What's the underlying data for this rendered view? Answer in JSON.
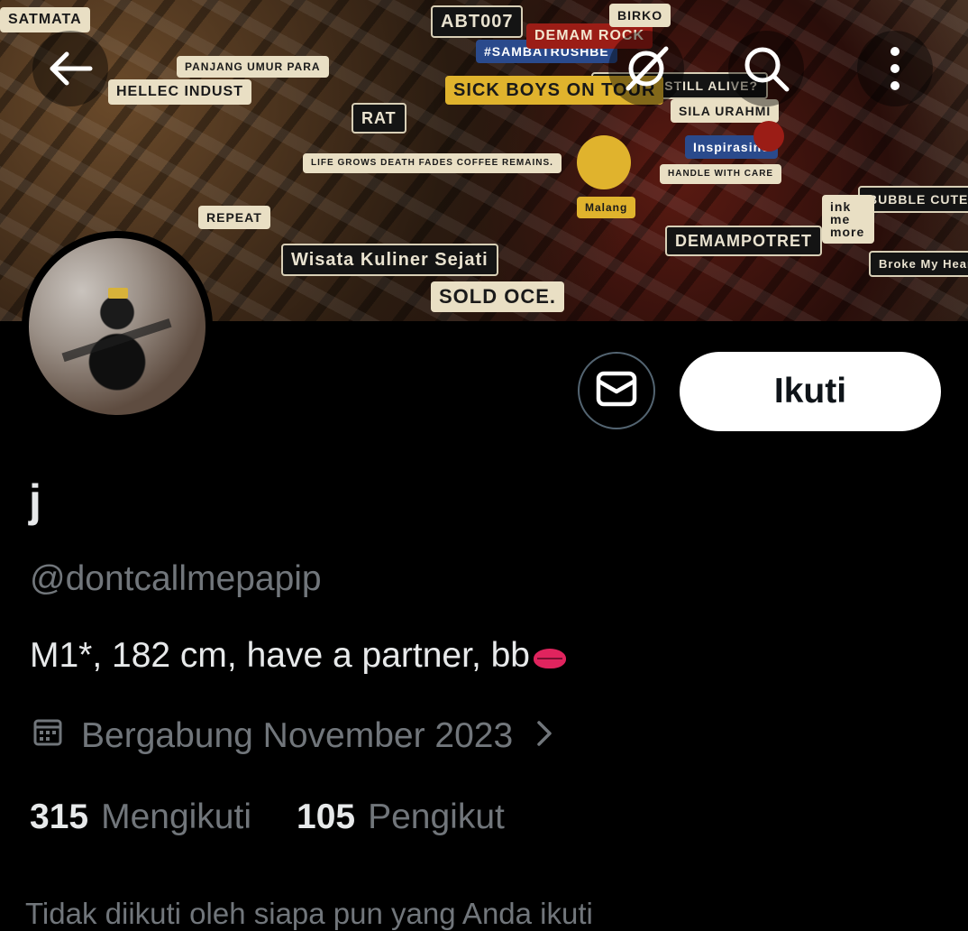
{
  "banner": {
    "stickers": [
      "SATMATA",
      "PANJANG UMUR PARA",
      "ABT007",
      "#SAMBATRUSHBE",
      "DEMAM ROCK",
      "IS ROCK STILL ALIVE?",
      "BIRKO",
      "SICK BOYS ON TOUR",
      "SILA URAHMI",
      "HELLEC INDUST",
      "LIFE GROWS DEATH FADES COFFEE REMAINS.",
      "RAT",
      "Inspirasine",
      "HANDLE WITH CARE",
      "BUBBLE CUTE",
      "Malang",
      "DEMAMPOTRET",
      "Wisata Kuliner Sejati",
      "ink me more",
      "Broke My Heart.",
      "REPEAT",
      "SOLD OCE."
    ]
  },
  "profile": {
    "display_name": "j",
    "handle": "@dontcallmepapip",
    "bio": "M1*, 182 cm, have a partner, bb",
    "joined": "Bergabung November 2023",
    "following_count": "315",
    "following_label": "Mengikuti",
    "followers_count": "105",
    "followers_label": "Pengikut",
    "followed_by_note": "Tidak diikuti oleh siapa pun yang Anda ikuti"
  },
  "actions": {
    "follow_label": "Ikuti"
  },
  "icons": {
    "back": "arrow-left-icon",
    "grok": "grok-icon",
    "search": "search-icon",
    "more": "more-vertical-icon",
    "message": "envelope-icon",
    "calendar": "calendar-icon",
    "chevron": "chevron-right-icon"
  },
  "colors": {
    "background": "#000000",
    "primary_text": "#e7e9ea",
    "secondary_text": "#71767b",
    "follow_button_bg": "#ffffff",
    "follow_button_text": "#0f1419",
    "border": "#536471"
  }
}
